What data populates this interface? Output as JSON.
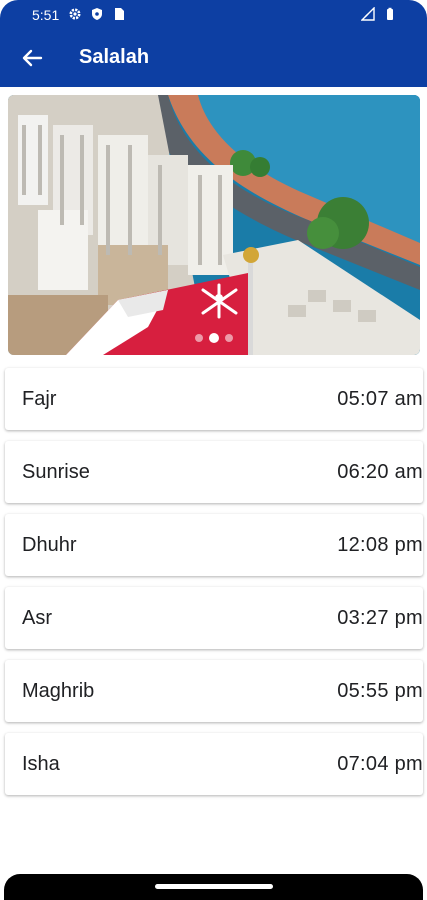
{
  "status_bar": {
    "time": "5:51"
  },
  "header": {
    "title": "Salalah"
  },
  "carousel": {
    "slide_count": 3,
    "active_index": 1
  },
  "prayers": [
    {
      "name": "Fajr",
      "time": "05:07 am"
    },
    {
      "name": "Sunrise",
      "time": "06:20 am"
    },
    {
      "name": "Dhuhr",
      "time": "12:08 pm"
    },
    {
      "name": "Asr",
      "time": "03:27 pm"
    },
    {
      "name": "Maghrib",
      "time": "05:55 pm"
    },
    {
      "name": "Isha",
      "time": "07:04 pm"
    }
  ],
  "colors": {
    "primary": "#0d3fa3",
    "flag_red": "#d71f3f",
    "sea": "#1a7ca8"
  }
}
